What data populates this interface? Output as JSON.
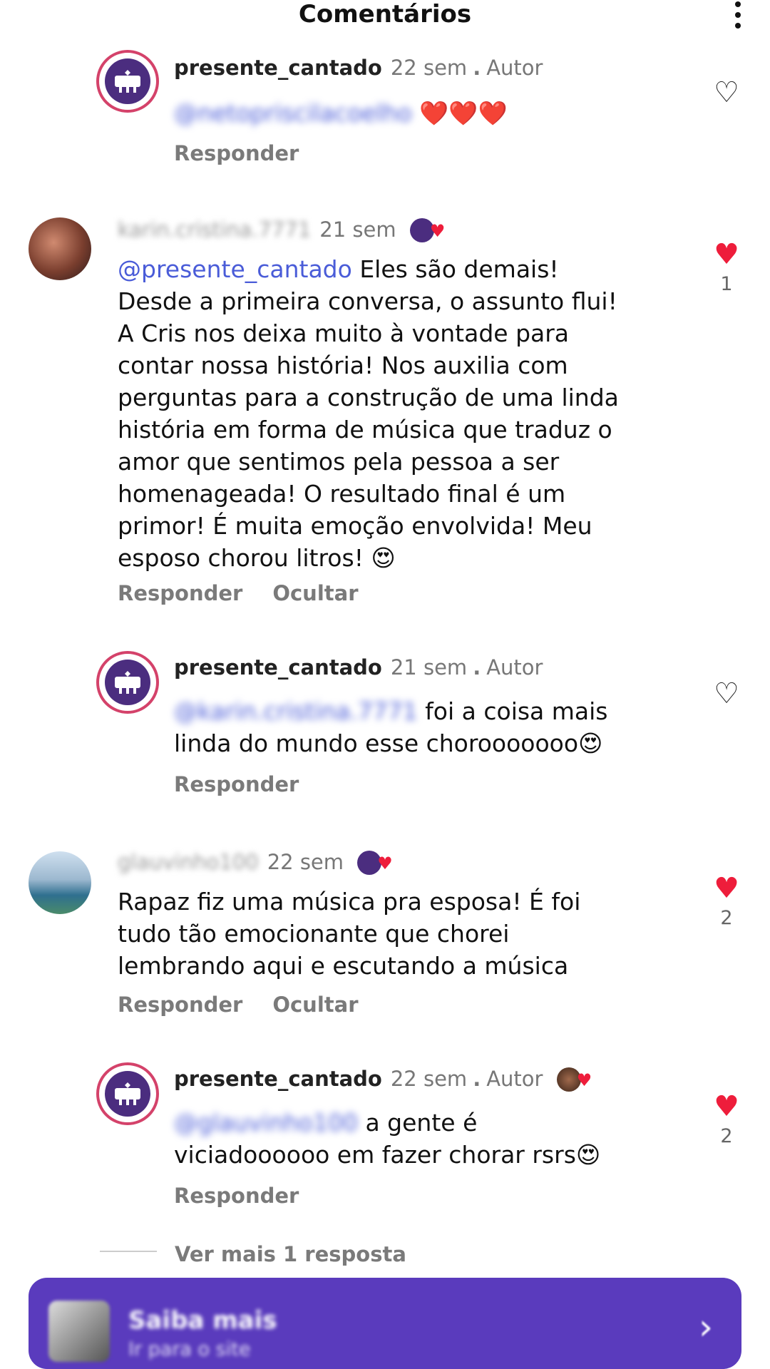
{
  "header": {
    "title": "Comentários"
  },
  "comments": [
    {
      "username": "presente_cantado",
      "time": "22 sem",
      "author": "Autor",
      "mention": "@netopriscilacoelho",
      "text": " ❤️❤️❤️",
      "reply": "Responder"
    },
    {
      "username": "karin.cristina.7771",
      "time": "21 sem",
      "mention": "@presente_cantado",
      "text_lines": [
        "Eles são demais!",
        "Desde a primeira conversa, o assunto flui!",
        "A Cris nos deixa muito à vontade para",
        "contar nossa história! Nos auxilia com",
        "perguntas para a construção de uma linda",
        "história em forma de música que traduz o",
        "amor que sentimos pela pessoa a ser",
        "homenageada! O resultado final é um",
        "primor! É muita emoção envolvida! Meu",
        "esposo chorou litros! 😍"
      ],
      "reply": "Responder",
      "hide": "Ocultar",
      "likes": "1"
    },
    {
      "username": "presente_cantado",
      "time": "21 sem",
      "author": "Autor",
      "mention": "@karin.cristina.7771",
      "text_line1": " foi a coisa mais",
      "text_line2": "linda do mundo esse chorooooooo😍",
      "reply": "Responder"
    },
    {
      "username": "glauvinho100",
      "time": "22 sem",
      "text_lines": [
        "Rapaz fiz  uma música pra esposa! É foi",
        "tudo tão emocionante que chorei",
        "lembrando aqui e escutando a música"
      ],
      "reply": "Responder",
      "hide": "Ocultar",
      "likes": "2"
    },
    {
      "username": "presente_cantado",
      "time": "22 sem",
      "author": "Autor",
      "mention": "@glauvinho100",
      "text_line1": " a gente é",
      "text_line2": "viciadoooooo em fazer chorar rsrs😍",
      "reply": "Responder",
      "likes": "2"
    }
  ],
  "view_more": "Ver mais 1 resposta",
  "cta": {
    "title": "Saiba mais",
    "subtitle": "Ir para o site"
  },
  "colors": {
    "accent": "#5a3bbd",
    "heart": "#ee1d3b",
    "mention": "#4a5cd8"
  }
}
